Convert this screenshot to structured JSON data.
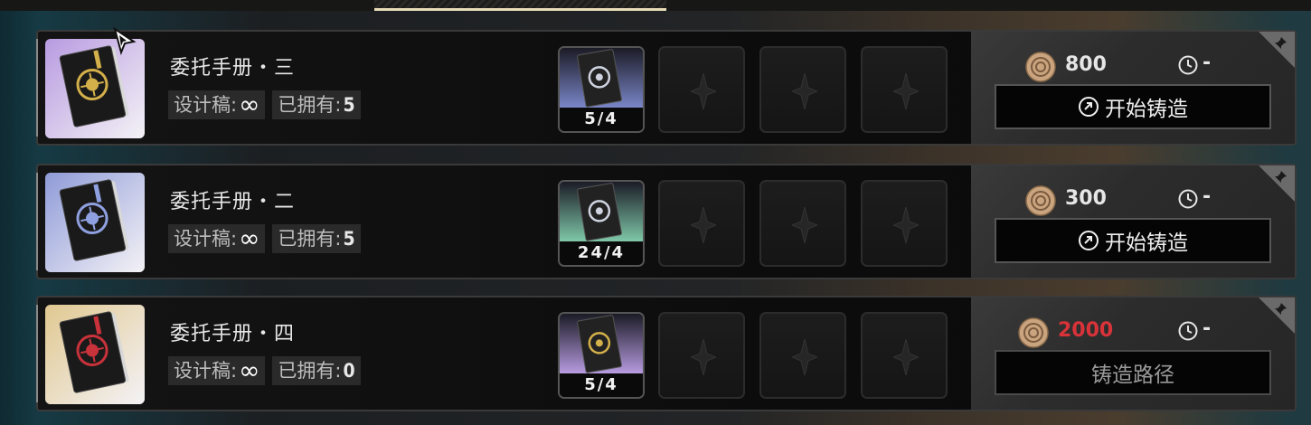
{
  "labels": {
    "blueprint": "设计稿:",
    "owned": "已拥有:",
    "infinite": "∞",
    "dash": "-"
  },
  "colors": {
    "accent_red": "#d9333a",
    "gold": "#e8ddb8"
  },
  "rows": [
    {
      "name": "委托手册・三",
      "owned": "5",
      "material_count": "5/4",
      "cost": "800",
      "cost_insufficient": false,
      "button": "开始铸造",
      "button_icon": "forge-icon",
      "book_color": "#b89be0",
      "emblem": "#d4b04a"
    },
    {
      "name": "委托手册・二",
      "owned": "5",
      "material_count": "24/4",
      "cost": "300",
      "cost_insufficient": false,
      "button": "开始铸造",
      "button_icon": "forge-icon",
      "book_color": "#8f9bd8",
      "emblem": "#8fa0e0"
    },
    {
      "name": "委托手册・四",
      "owned": "0",
      "material_count": "5/4",
      "cost": "2000",
      "cost_insufficient": true,
      "button": "铸造路径",
      "button_icon": "",
      "book_color": "#e0c890",
      "emblem": "#c8323a"
    }
  ],
  "material_thumb_colors": [
    "#7a86c8",
    "#7fc8a8",
    "#b79be0"
  ]
}
